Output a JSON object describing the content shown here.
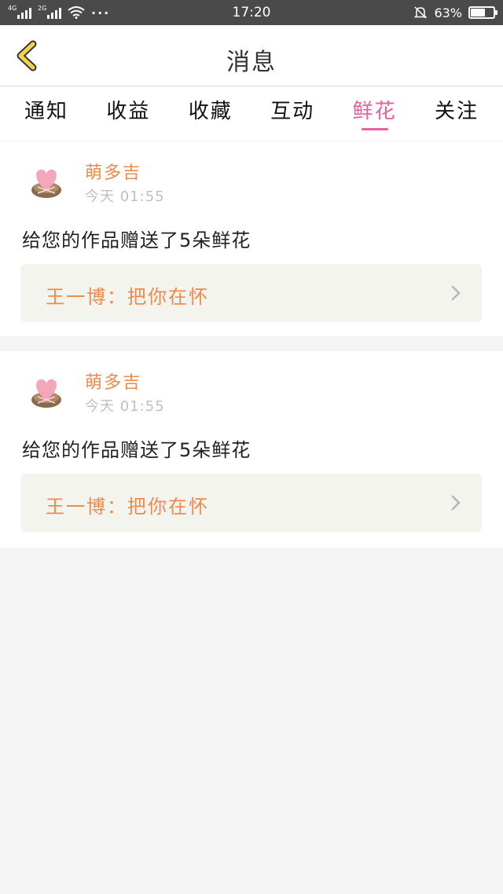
{
  "status_bar": {
    "network_1": "4G",
    "network_2": "2G",
    "time": "17:20",
    "battery": "63%",
    "battery_level": 0.63
  },
  "header": {
    "title": "消息"
  },
  "tabs": [
    {
      "label": "通知",
      "active": false
    },
    {
      "label": "收益",
      "active": false
    },
    {
      "label": "收藏",
      "active": false
    },
    {
      "label": "互动",
      "active": false
    },
    {
      "label": "鲜花",
      "active": true
    },
    {
      "label": "关注",
      "active": false
    }
  ],
  "notifications": [
    {
      "username": "萌多吉",
      "time": "今天 01:55",
      "message": "给您的作品赠送了5朵鲜花",
      "work": "王一博：把你在怀"
    },
    {
      "username": "萌多吉",
      "time": "今天 01:55",
      "message": "给您的作品赠送了5朵鲜花",
      "work": "王一博：把你在怀"
    }
  ],
  "colors": {
    "accent": "#e8609c",
    "username": "#f08a4b",
    "back_icon": "#f2d44a"
  }
}
